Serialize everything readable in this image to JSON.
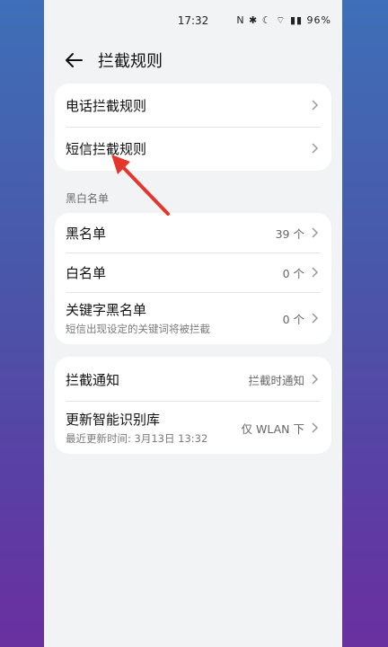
{
  "status": {
    "time": "17:32",
    "icons_text": "N ✱ ☾ ⌔ ▮▮ 96%"
  },
  "header": {
    "title": "拦截规则"
  },
  "rules_card": {
    "items": [
      {
        "label": "电话拦截规则"
      },
      {
        "label": "短信拦截规则"
      }
    ]
  },
  "lists_section": {
    "title": "黑白名单",
    "items": [
      {
        "label": "黑名单",
        "value": "39 个"
      },
      {
        "label": "白名单",
        "value": "0 个"
      },
      {
        "label": "关键字黑名单",
        "sub": "短信出现设定的关键词将被拦截",
        "value": "0 个"
      }
    ]
  },
  "settings_card": {
    "items": [
      {
        "label": "拦截通知",
        "value": "拦截时通知"
      },
      {
        "label": "更新智能识别库",
        "sub": "最近更新时间: 3月13日 13:32",
        "value": "仅 WLAN 下"
      }
    ]
  },
  "colors": {
    "arrow": "#e5362c",
    "background_top": "#3f6fb8",
    "background_bottom": "#6a2fa0"
  }
}
